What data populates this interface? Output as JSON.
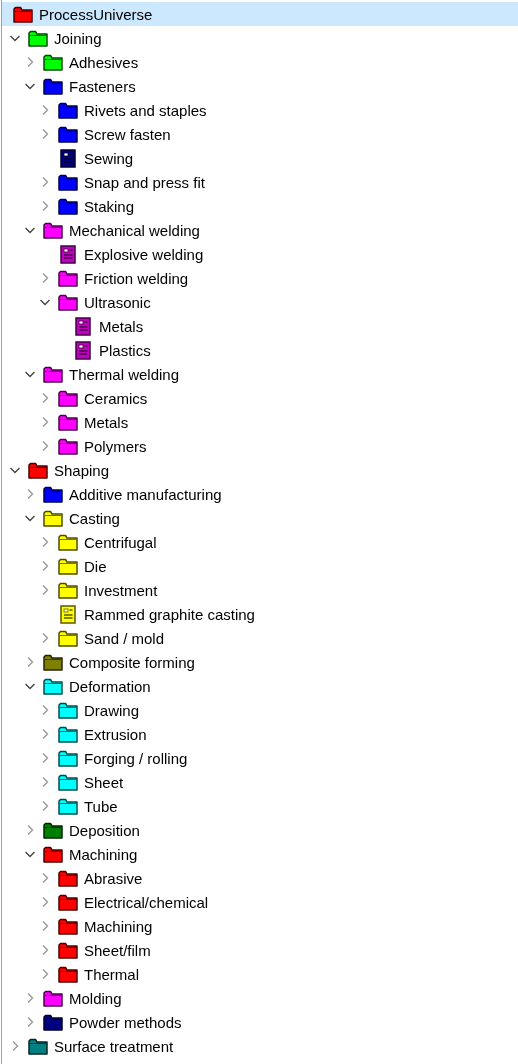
{
  "tree": {
    "root": {
      "label": "ProcessUniverse",
      "color": "#ff0000",
      "selected": true,
      "children": [
        {
          "label": "Joining",
          "kind": "folder",
          "color": "#00ff00",
          "expanded": true,
          "children": [
            {
              "label": "Adhesives",
              "kind": "folder",
              "color": "#00ff00",
              "expanded": false
            },
            {
              "label": "Fasteners",
              "kind": "folder",
              "color": "#0000ff",
              "expanded": true,
              "children": [
                {
                  "label": "Rivets and staples",
                  "kind": "folder",
                  "color": "#0000ff",
                  "expanded": false
                },
                {
                  "label": "Screw fasten",
                  "kind": "folder",
                  "color": "#0000ff",
                  "expanded": false
                },
                {
                  "label": "Sewing",
                  "kind": "document",
                  "color": "#000080"
                },
                {
                  "label": "Snap and press fit",
                  "kind": "folder",
                  "color": "#0000ff",
                  "expanded": false
                },
                {
                  "label": "Staking",
                  "kind": "folder",
                  "color": "#0000ff",
                  "expanded": false
                }
              ]
            },
            {
              "label": "Mechanical welding",
              "kind": "folder",
              "color": "#ff00ff",
              "expanded": true,
              "children": [
                {
                  "label": "Explosive welding",
                  "kind": "document",
                  "color": "#c000c0"
                },
                {
                  "label": "Friction welding",
                  "kind": "folder",
                  "color": "#ff00ff",
                  "expanded": false
                },
                {
                  "label": "Ultrasonic",
                  "kind": "folder",
                  "color": "#ff00ff",
                  "expanded": true,
                  "children": [
                    {
                      "label": "Metals",
                      "kind": "document",
                      "color": "#c000c0"
                    },
                    {
                      "label": "Plastics",
                      "kind": "document",
                      "color": "#c000c0"
                    }
                  ]
                }
              ]
            },
            {
              "label": "Thermal welding",
              "kind": "folder",
              "color": "#ff00ff",
              "expanded": true,
              "children": [
                {
                  "label": "Ceramics",
                  "kind": "folder",
                  "color": "#ff00ff",
                  "expanded": false
                },
                {
                  "label": "Metals",
                  "kind": "folder",
                  "color": "#ff00ff",
                  "expanded": false
                },
                {
                  "label": "Polymers",
                  "kind": "folder",
                  "color": "#ff00ff",
                  "expanded": false
                }
              ]
            }
          ]
        },
        {
          "label": "Shaping",
          "kind": "folder",
          "color": "#ff0000",
          "expanded": true,
          "children": [
            {
              "label": "Additive manufacturing",
              "kind": "folder",
              "color": "#0000ff",
              "expanded": false
            },
            {
              "label": "Casting",
              "kind": "folder",
              "color": "#ffff00",
              "expanded": true,
              "children": [
                {
                  "label": "Centrifugal",
                  "kind": "folder",
                  "color": "#ffff00",
                  "expanded": false
                },
                {
                  "label": "Die",
                  "kind": "folder",
                  "color": "#ffff00",
                  "expanded": false
                },
                {
                  "label": "Investment",
                  "kind": "folder",
                  "color": "#ffff00",
                  "expanded": false
                },
                {
                  "label": "Rammed graphite casting",
                  "kind": "document",
                  "color": "#ffff00"
                },
                {
                  "label": "Sand / mold",
                  "kind": "folder",
                  "color": "#ffff00",
                  "expanded": false
                }
              ]
            },
            {
              "label": "Composite forming",
              "kind": "folder",
              "color": "#808000",
              "expanded": false
            },
            {
              "label": "Deformation",
              "kind": "folder",
              "color": "#00ffff",
              "expanded": true,
              "children": [
                {
                  "label": "Drawing",
                  "kind": "folder",
                  "color": "#00ffff",
                  "expanded": false
                },
                {
                  "label": "Extrusion",
                  "kind": "folder",
                  "color": "#00ffff",
                  "expanded": false
                },
                {
                  "label": "Forging / rolling",
                  "kind": "folder",
                  "color": "#00ffff",
                  "expanded": false
                },
                {
                  "label": "Sheet",
                  "kind": "folder",
                  "color": "#00ffff",
                  "expanded": false
                },
                {
                  "label": "Tube",
                  "kind": "folder",
                  "color": "#00ffff",
                  "expanded": false
                }
              ]
            },
            {
              "label": "Deposition",
              "kind": "folder",
              "color": "#008000",
              "expanded": false
            },
            {
              "label": "Machining",
              "kind": "folder",
              "color": "#ff0000",
              "expanded": true,
              "children": [
                {
                  "label": "Abrasive",
                  "kind": "folder",
                  "color": "#ff0000",
                  "expanded": false
                },
                {
                  "label": "Electrical/chemical",
                  "kind": "folder",
                  "color": "#ff0000",
                  "expanded": false
                },
                {
                  "label": "Machining",
                  "kind": "folder",
                  "color": "#ff0000",
                  "expanded": false
                },
                {
                  "label": "Sheet/film",
                  "kind": "folder",
                  "color": "#ff0000",
                  "expanded": false
                },
                {
                  "label": "Thermal",
                  "kind": "folder",
                  "color": "#ff0000",
                  "expanded": false
                }
              ]
            },
            {
              "label": "Molding",
              "kind": "folder",
              "color": "#ff00ff",
              "expanded": false
            },
            {
              "label": "Powder methods",
              "kind": "folder",
              "color": "#000080",
              "expanded": false
            }
          ]
        },
        {
          "label": "Surface treatment",
          "kind": "folder",
          "color": "#008080",
          "expanded": false
        }
      ]
    }
  }
}
